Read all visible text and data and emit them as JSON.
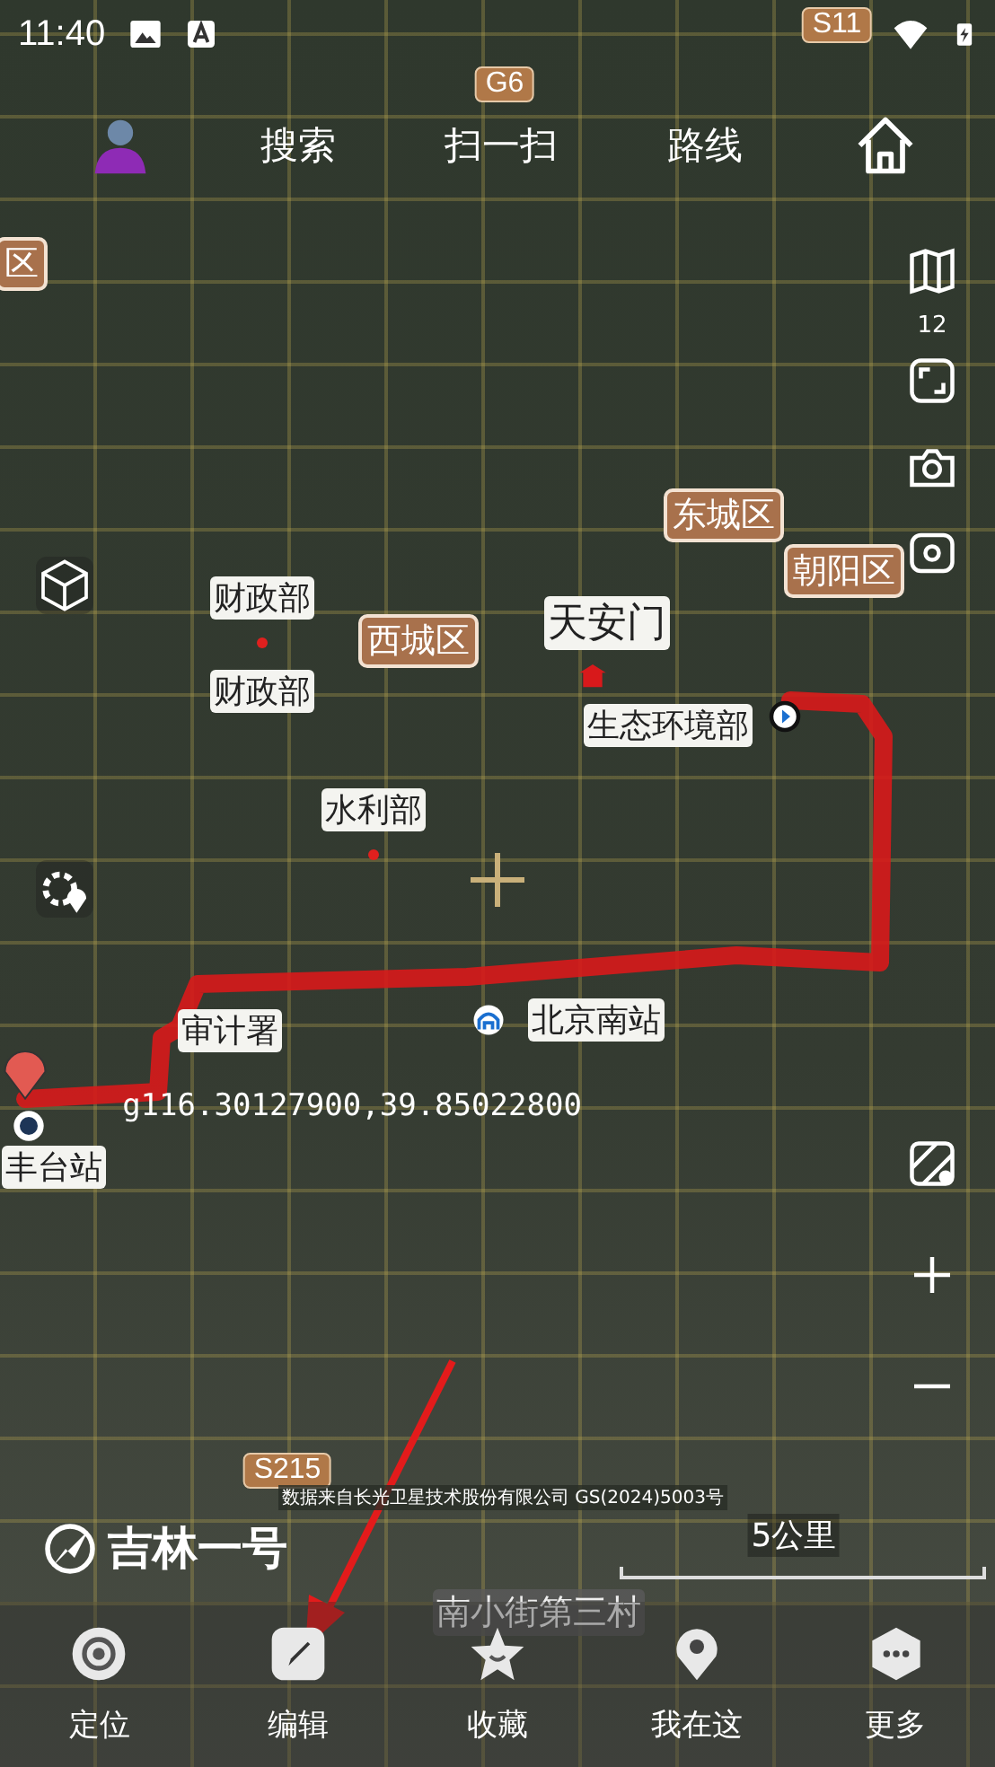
{
  "status_bar": {
    "time": "11:40"
  },
  "top_bar": {
    "items": [
      {
        "label": "搜索"
      },
      {
        "label": "扫一扫"
      },
      {
        "label": "路线"
      }
    ]
  },
  "right_controls": {
    "zoom_level": "12"
  },
  "map": {
    "shields": [
      {
        "label": "G6"
      },
      {
        "label": "S11"
      },
      {
        "label": "S215"
      }
    ],
    "districts": [
      {
        "label": "区"
      },
      {
        "label": "东城区"
      },
      {
        "label": "朝阳区"
      },
      {
        "label": "西城区"
      }
    ],
    "places": [
      {
        "label": "财政部",
        "kind": "dot"
      },
      {
        "label": "财政部",
        "kind": "plain"
      },
      {
        "label": "天安门",
        "kind": "gate"
      },
      {
        "label": "生态环境部",
        "kind": "poi"
      },
      {
        "label": "水利部",
        "kind": "dot"
      },
      {
        "label": "审计署",
        "kind": "plain"
      },
      {
        "label": "北京南站",
        "kind": "station"
      },
      {
        "label": "丰台站",
        "kind": "plain"
      },
      {
        "label": "南小街第三村",
        "kind": "faint"
      }
    ],
    "coordinate": "g116.30127900,39.85022800",
    "attribution": "数据来自长光卫星技术股份有限公司 GS(2024)5003号",
    "brand": "吉林一号",
    "scale": "5公里"
  },
  "bottom_nav": [
    {
      "label": "定位"
    },
    {
      "label": "编辑"
    },
    {
      "label": "收藏"
    },
    {
      "label": "我在这"
    },
    {
      "label": "更多"
    }
  ]
}
